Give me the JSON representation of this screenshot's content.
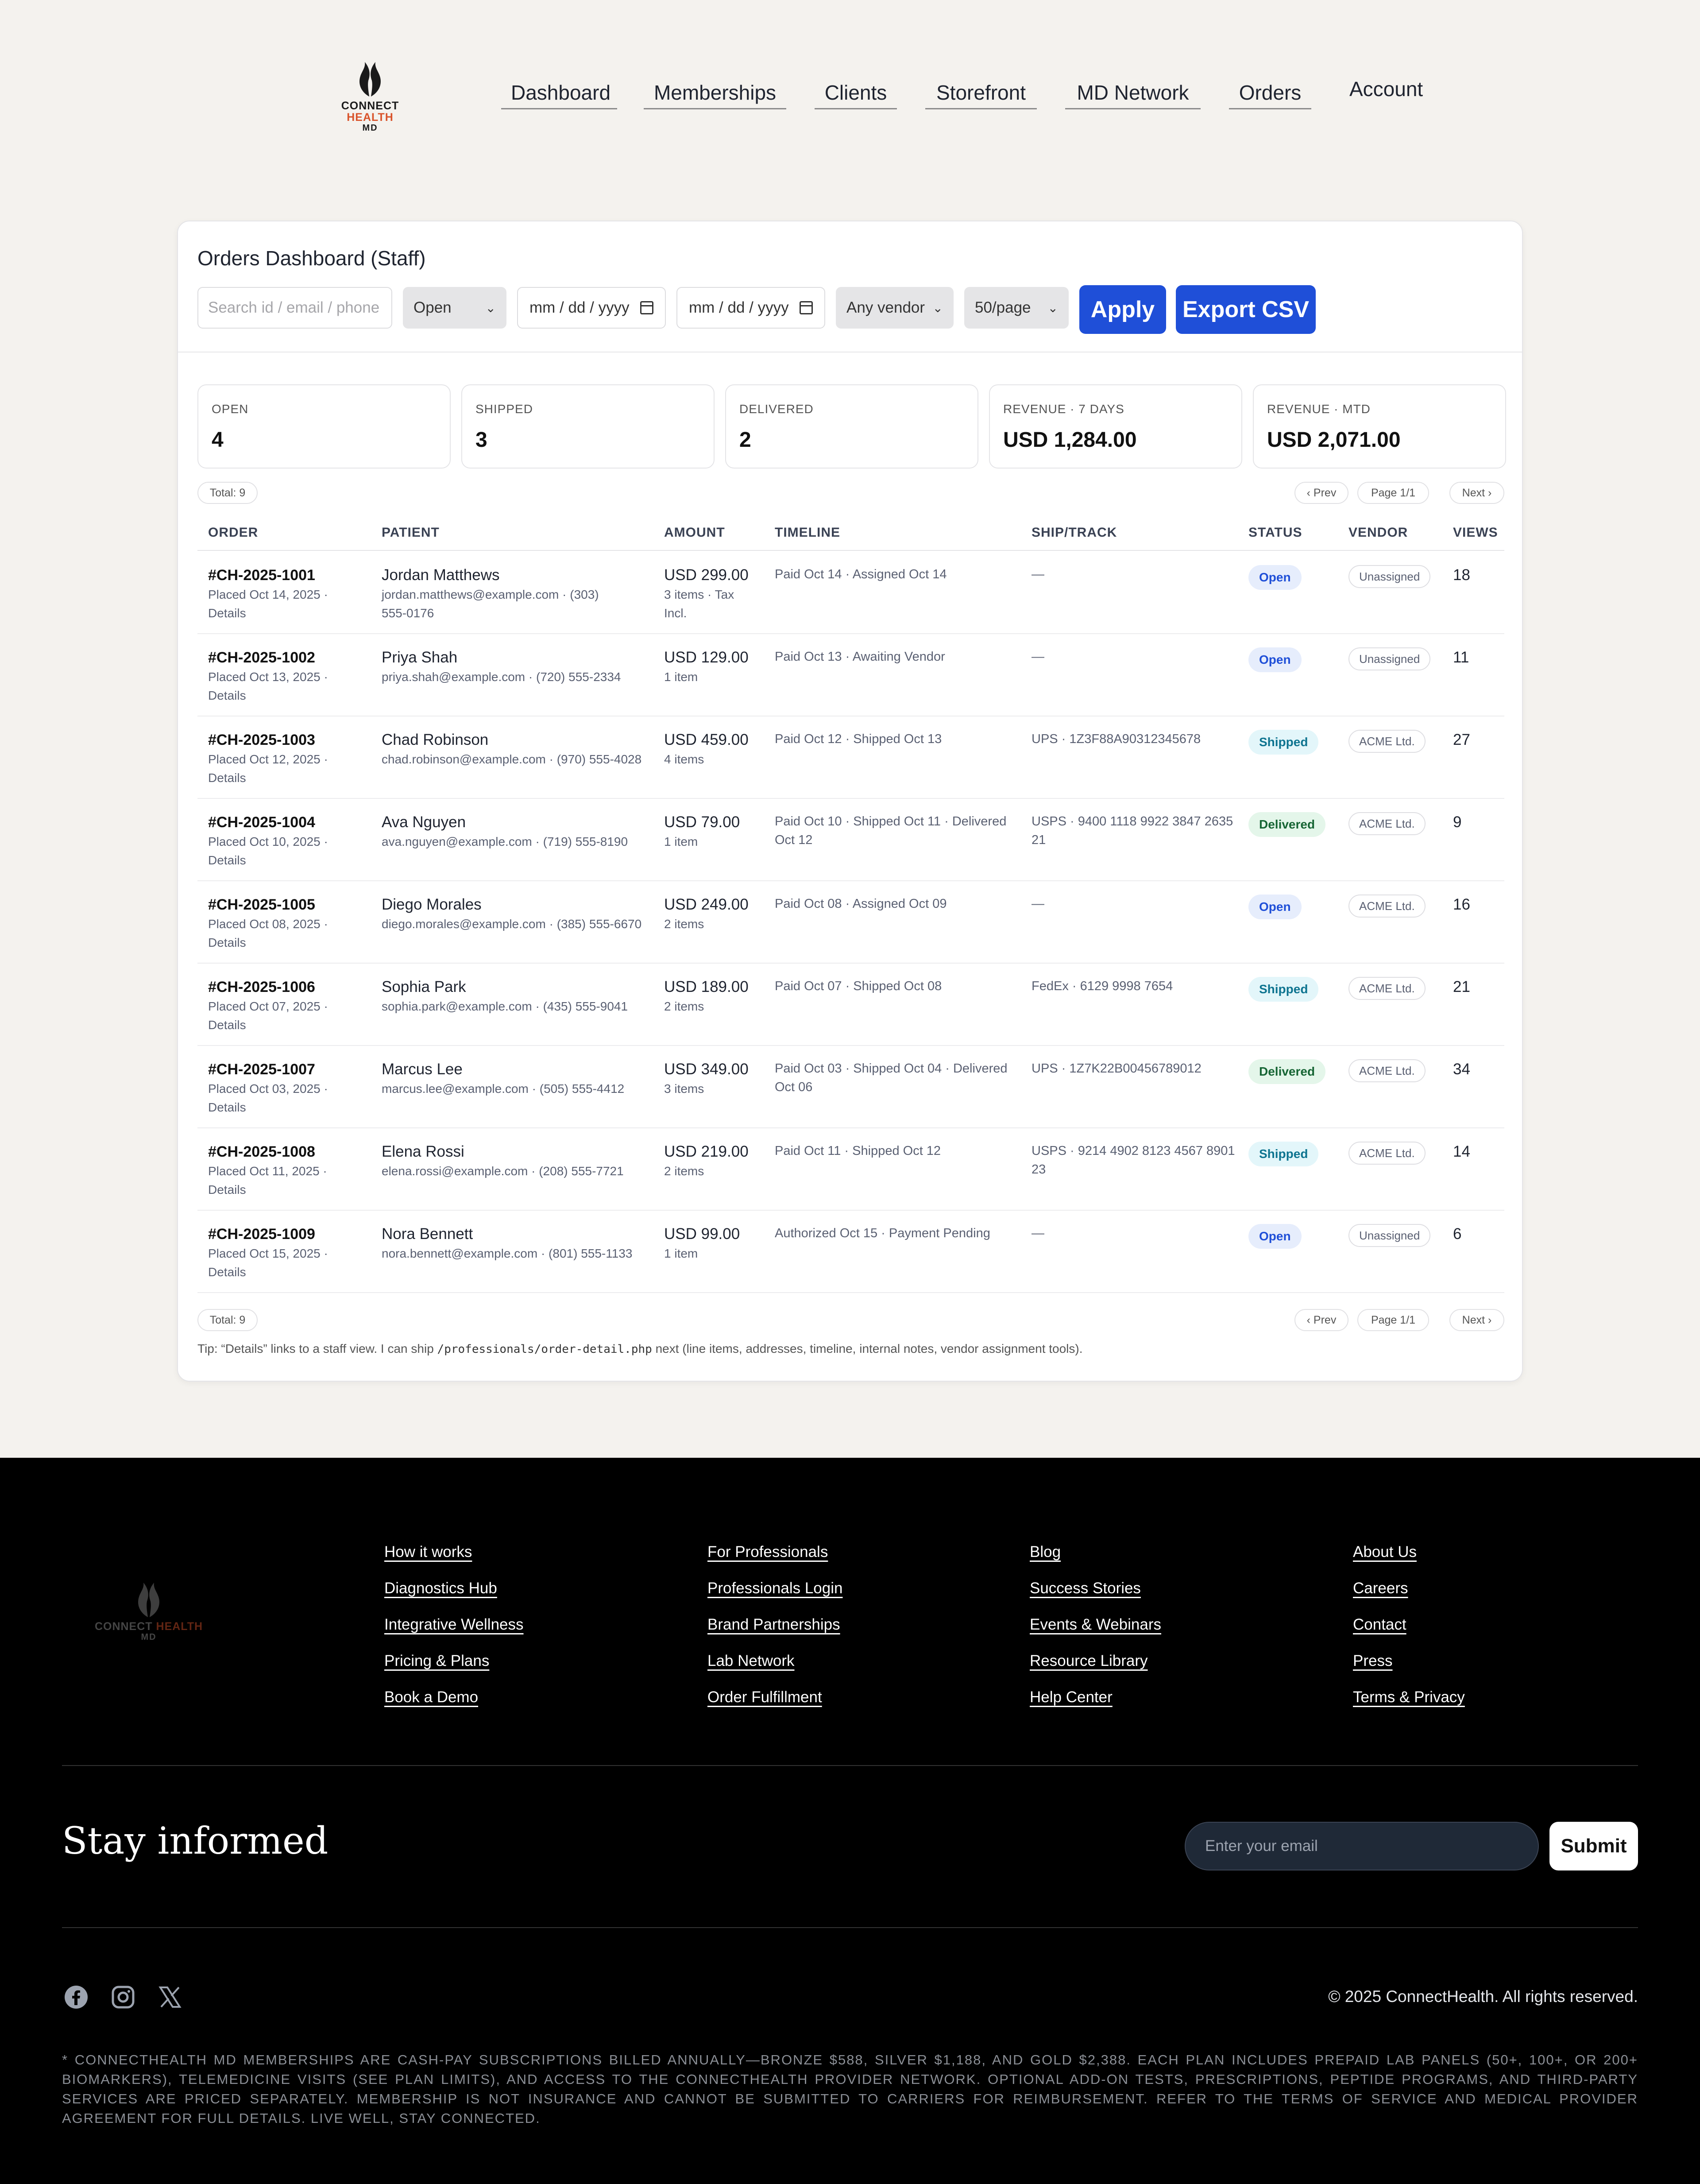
{
  "brand": {
    "name_part1": "CONNECT ",
    "name_part2": "HEALTH",
    "name_sub": "MD"
  },
  "nav": [
    "Dashboard",
    "Memberships",
    "Clients",
    "Storefront",
    "MD Network",
    "Orders",
    "Account"
  ],
  "card": {
    "title": "Orders Dashboard (Staff)",
    "search_placeholder": "Search id / email / phone / name",
    "status_filter": "Open",
    "date_from": "mm / dd / yyyy",
    "date_to": "mm / dd / yyyy",
    "vendor_filter": "Any vendor",
    "page_size": "50/page",
    "apply_label": "Apply",
    "export_label": "Export CSV"
  },
  "stats": [
    {
      "label": "OPEN",
      "value": "4"
    },
    {
      "label": "SHIPPED",
      "value": "3"
    },
    {
      "label": "DELIVERED",
      "value": "2"
    },
    {
      "label": "REVENUE · 7 DAYS",
      "value": "USD 1,284.00"
    },
    {
      "label": "REVENUE · MTD",
      "value": "USD 2,071.00"
    }
  ],
  "pagination": {
    "total": "Total: 9",
    "prev": "‹ Prev",
    "page": "Page 1/1",
    "next": "Next ›"
  },
  "columns": [
    "ORDER",
    "PATIENT",
    "AMOUNT",
    "TIMELINE",
    "SHIP/TRACK",
    "STATUS",
    "VENDOR",
    "VIEWS"
  ],
  "orders": [
    {
      "id": "#CH-2025-1001",
      "placed": "Placed Oct 14, 2025 ·",
      "details": "Details",
      "patient": "Jordan Matthews",
      "contact1": "jordan.matthews@example.com · (303)",
      "contact2": "555-0176",
      "amount": "USD 299.00",
      "items1": "3 items · Tax",
      "items2": "Incl.",
      "tl1": "Paid Oct 14 · Assigned Oct 14",
      "tl2": "",
      "ship1": "—",
      "ship2": "",
      "status": "Open",
      "vendor": "Unassigned",
      "views": "18"
    },
    {
      "id": "#CH-2025-1002",
      "placed": "Placed Oct 13, 2025 ·",
      "details": "Details",
      "patient": "Priya Shah",
      "contact1": "priya.shah@example.com · (720) 555-2334",
      "contact2": "",
      "amount": "USD 129.00",
      "items1": "1 item",
      "items2": "",
      "tl1": "Paid Oct 13 · Awaiting Vendor",
      "tl2": "",
      "ship1": "—",
      "ship2": "",
      "status": "Open",
      "vendor": "Unassigned",
      "views": "11"
    },
    {
      "id": "#CH-2025-1003",
      "placed": "Placed Oct 12, 2025 ·",
      "details": "Details",
      "patient": "Chad Robinson",
      "contact1": "chad.robinson@example.com · (970) 555-4028",
      "contact2": "",
      "amount": "USD 459.00",
      "items1": "4 items",
      "items2": "",
      "tl1": "Paid Oct 12 · Shipped Oct 13",
      "tl2": "",
      "ship1": "UPS · 1Z3F88A90312345678",
      "ship2": "",
      "status": "Shipped",
      "vendor": "ACME Ltd.",
      "views": "27"
    },
    {
      "id": "#CH-2025-1004",
      "placed": "Placed Oct 10, 2025 ·",
      "details": "Details",
      "patient": "Ava Nguyen",
      "contact1": "ava.nguyen@example.com · (719) 555-8190",
      "contact2": "",
      "amount": "USD 79.00",
      "items1": "1 item",
      "items2": "",
      "tl1": "Paid Oct 10 · Shipped Oct 11 · Delivered",
      "tl2": "Oct 12",
      "ship1": "USPS · 9400 1118 9922 3847 2635",
      "ship2": "21",
      "status": "Delivered",
      "vendor": "ACME Ltd.",
      "views": "9"
    },
    {
      "id": "#CH-2025-1005",
      "placed": "Placed Oct 08, 2025 ·",
      "details": "Details",
      "patient": "Diego Morales",
      "contact1": "diego.morales@example.com · (385) 555-6670",
      "contact2": "",
      "amount": "USD 249.00",
      "items1": "2 items",
      "items2": "",
      "tl1": "Paid Oct 08 · Assigned Oct 09",
      "tl2": "",
      "ship1": "—",
      "ship2": "",
      "status": "Open",
      "vendor": "ACME Ltd.",
      "views": "16"
    },
    {
      "id": "#CH-2025-1006",
      "placed": "Placed Oct 07, 2025 ·",
      "details": "Details",
      "patient": "Sophia Park",
      "contact1": "sophia.park@example.com · (435) 555-9041",
      "contact2": "",
      "amount": "USD 189.00",
      "items1": "2 items",
      "items2": "",
      "tl1": "Paid Oct 07 · Shipped Oct 08",
      "tl2": "",
      "ship1": "FedEx · 6129 9998 7654",
      "ship2": "",
      "status": "Shipped",
      "vendor": "ACME Ltd.",
      "views": "21"
    },
    {
      "id": "#CH-2025-1007",
      "placed": "Placed Oct 03, 2025 ·",
      "details": "Details",
      "patient": "Marcus Lee",
      "contact1": "marcus.lee@example.com · (505) 555-4412",
      "contact2": "",
      "amount": "USD 349.00",
      "items1": "3 items",
      "items2": "",
      "tl1": "Paid Oct 03 · Shipped Oct 04 · Delivered",
      "tl2": "Oct 06",
      "ship1": "UPS · 1Z7K22B00456789012",
      "ship2": "",
      "status": "Delivered",
      "vendor": "ACME Ltd.",
      "views": "34"
    },
    {
      "id": "#CH-2025-1008",
      "placed": "Placed Oct 11, 2025 ·",
      "details": "Details",
      "patient": "Elena Rossi",
      "contact1": "elena.rossi@example.com · (208) 555-7721",
      "contact2": "",
      "amount": "USD 219.00",
      "items1": "2 items",
      "items2": "",
      "tl1": "Paid Oct 11 · Shipped Oct 12",
      "tl2": "",
      "ship1": "USPS · 9214 4902 8123 4567 8901",
      "ship2": "23",
      "status": "Shipped",
      "vendor": "ACME Ltd.",
      "views": "14"
    },
    {
      "id": "#CH-2025-1009",
      "placed": "Placed Oct 15, 2025 ·",
      "details": "Details",
      "patient": "Nora Bennett",
      "contact1": "nora.bennett@example.com · (801) 555-1133",
      "contact2": "",
      "amount": "USD 99.00",
      "items1": "1 item",
      "items2": "",
      "tl1": "Authorized Oct 15 · Payment Pending",
      "tl2": "",
      "ship1": "—",
      "ship2": "",
      "status": "Open",
      "vendor": "Unassigned",
      "views": "6"
    }
  ],
  "tip": {
    "before": "Tip: “Details” links to a staff view. I can ship ",
    "code": "/professionals/order-detail.php",
    "after": " next (line items, addresses, timeline, internal notes, vendor assignment tools)."
  },
  "footer": {
    "columns": [
      [
        "How it works",
        "Diagnostics Hub",
        "Integrative Wellness",
        "Pricing & Plans",
        "Book a Demo"
      ],
      [
        "For Professionals",
        "Professionals Login",
        "Brand Partnerships",
        "Lab Network",
        "Order Fulfillment"
      ],
      [
        "Blog",
        "Success Stories",
        "Events & Webinars",
        "Resource Library",
        "Help Center"
      ],
      [
        "About Us",
        "Careers",
        "Contact",
        "Press",
        "Terms & Privacy"
      ]
    ],
    "stay_title": "Stay informed",
    "email_placeholder": "Enter your email",
    "submit_label": "Submit",
    "social_icons": [
      "facebook-icon",
      "instagram-icon",
      "x-icon"
    ],
    "copyright": "© 2025 ConnectHealth. All rights reserved.",
    "disclaimer": "* ConnectHealth MD memberships are cash-pay subscriptions billed annually—Bronze $588, Silver $1,188, and Gold $2,388. Each plan includes prepaid lab panels (50+, 100+, or 200+ biomarkers), telemedicine visits (see plan limits), and access to the ConnectHealth provider network. Optional add-on tests, prescriptions, peptide programs, and third-party services are priced separately. Membership is not insurance and cannot be submitted to carriers for reimbursement. Refer to the Terms of Service and Medical Provider Agreement for full details. Live well, stay connected."
  }
}
